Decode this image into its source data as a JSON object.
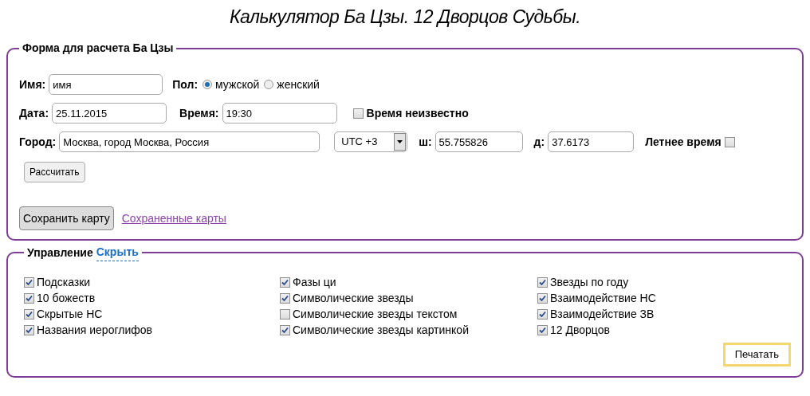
{
  "title": "Калькулятор Ба Цзы. 12 Дворцов Судьбы.",
  "form": {
    "legend": "Форма для расчета Ба Цзы",
    "name": {
      "label": "Имя:",
      "value": "имя"
    },
    "gender": {
      "label": "Пол:",
      "options": [
        {
          "label": "мужской",
          "selected": true
        },
        {
          "label": "женский",
          "selected": false
        }
      ]
    },
    "date": {
      "label": "Дата:",
      "value": "25.11.2015"
    },
    "time": {
      "label": "Время:",
      "value": "19:30"
    },
    "time_unknown": {
      "label": "Время неизвестно",
      "checked": false
    },
    "city": {
      "label": "Город:",
      "value": "Москва, город Москва, Россия"
    },
    "timezone": {
      "value": "UTC +3"
    },
    "lat": {
      "label": "ш:",
      "value": "55.755826"
    },
    "lon": {
      "label": "д:",
      "value": "37.6173"
    },
    "dst": {
      "label": "Летнее время",
      "checked": false
    },
    "calculate_button": "Рассчитать",
    "save_button": "Сохранить карту",
    "saved_link": "Сохраненные карты"
  },
  "controls": {
    "legend": "Управление",
    "toggle_link": "Скрыть",
    "columns": [
      [
        {
          "label": "Подсказки",
          "checked": true
        },
        {
          "label": "10 божеств",
          "checked": true
        },
        {
          "label": "Скрытые НС",
          "checked": true
        },
        {
          "label": "Названия иероглифов",
          "checked": true
        }
      ],
      [
        {
          "label": "Фазы ци",
          "checked": true
        },
        {
          "label": "Символические звезды",
          "checked": true
        },
        {
          "label": "Символические звезды текстом",
          "checked": false
        },
        {
          "label": "Символические звезды картинкой",
          "checked": true
        }
      ],
      [
        {
          "label": "Звезды по году",
          "checked": true
        },
        {
          "label": "Взаимодействие НС",
          "checked": true
        },
        {
          "label": "Взаимодействие ЗВ",
          "checked": true
        },
        {
          "label": "12 Дворцов",
          "checked": true
        }
      ]
    ],
    "print_button": "Печатать"
  }
}
